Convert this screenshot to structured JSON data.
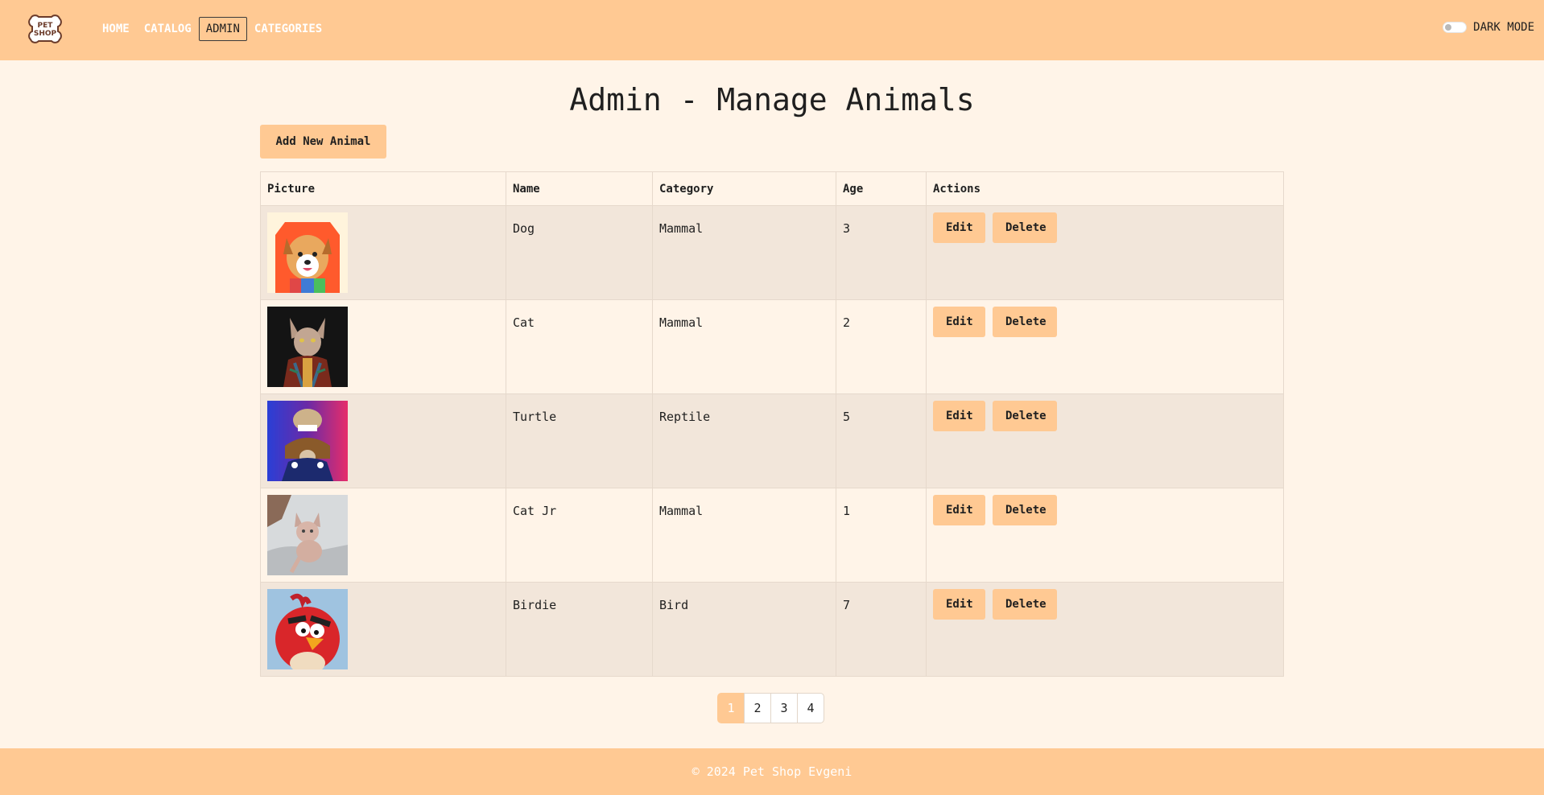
{
  "nav": {
    "logo_text_1": "PET",
    "logo_text_2": "SHOP",
    "links": [
      "HOME",
      "CATALOG",
      "ADMIN",
      "CATEGORIES"
    ],
    "active": "ADMIN",
    "dark_mode_label": "DARK MODE",
    "dark_mode_on": false
  },
  "page": {
    "title": "Admin - Manage Animals",
    "add_button": "Add New Animal"
  },
  "table": {
    "headers": [
      "Picture",
      "Name",
      "Category",
      "Age",
      "Actions"
    ],
    "rows": [
      {
        "name": "Dog",
        "category": "Mammal",
        "age": "3",
        "picture": "dog-picture"
      },
      {
        "name": "Cat",
        "category": "Mammal",
        "age": "2",
        "picture": "cat-picture"
      },
      {
        "name": "Turtle",
        "category": "Reptile",
        "age": "5",
        "picture": "turtle-picture"
      },
      {
        "name": "Cat Jr",
        "category": "Mammal",
        "age": "1",
        "picture": "kitten-picture"
      },
      {
        "name": "Birdie",
        "category": "Bird",
        "age": "7",
        "picture": "bird-picture"
      }
    ],
    "edit_label": "Edit",
    "delete_label": "Delete"
  },
  "pagination": {
    "pages": [
      "1",
      "2",
      "3",
      "4"
    ],
    "current": "1"
  },
  "footer": {
    "text": "© 2024 Pet Shop Evgeni"
  },
  "colors": {
    "accent": "#ffc993",
    "background": "#fff4e8",
    "row_alt": "#f2e6da"
  }
}
